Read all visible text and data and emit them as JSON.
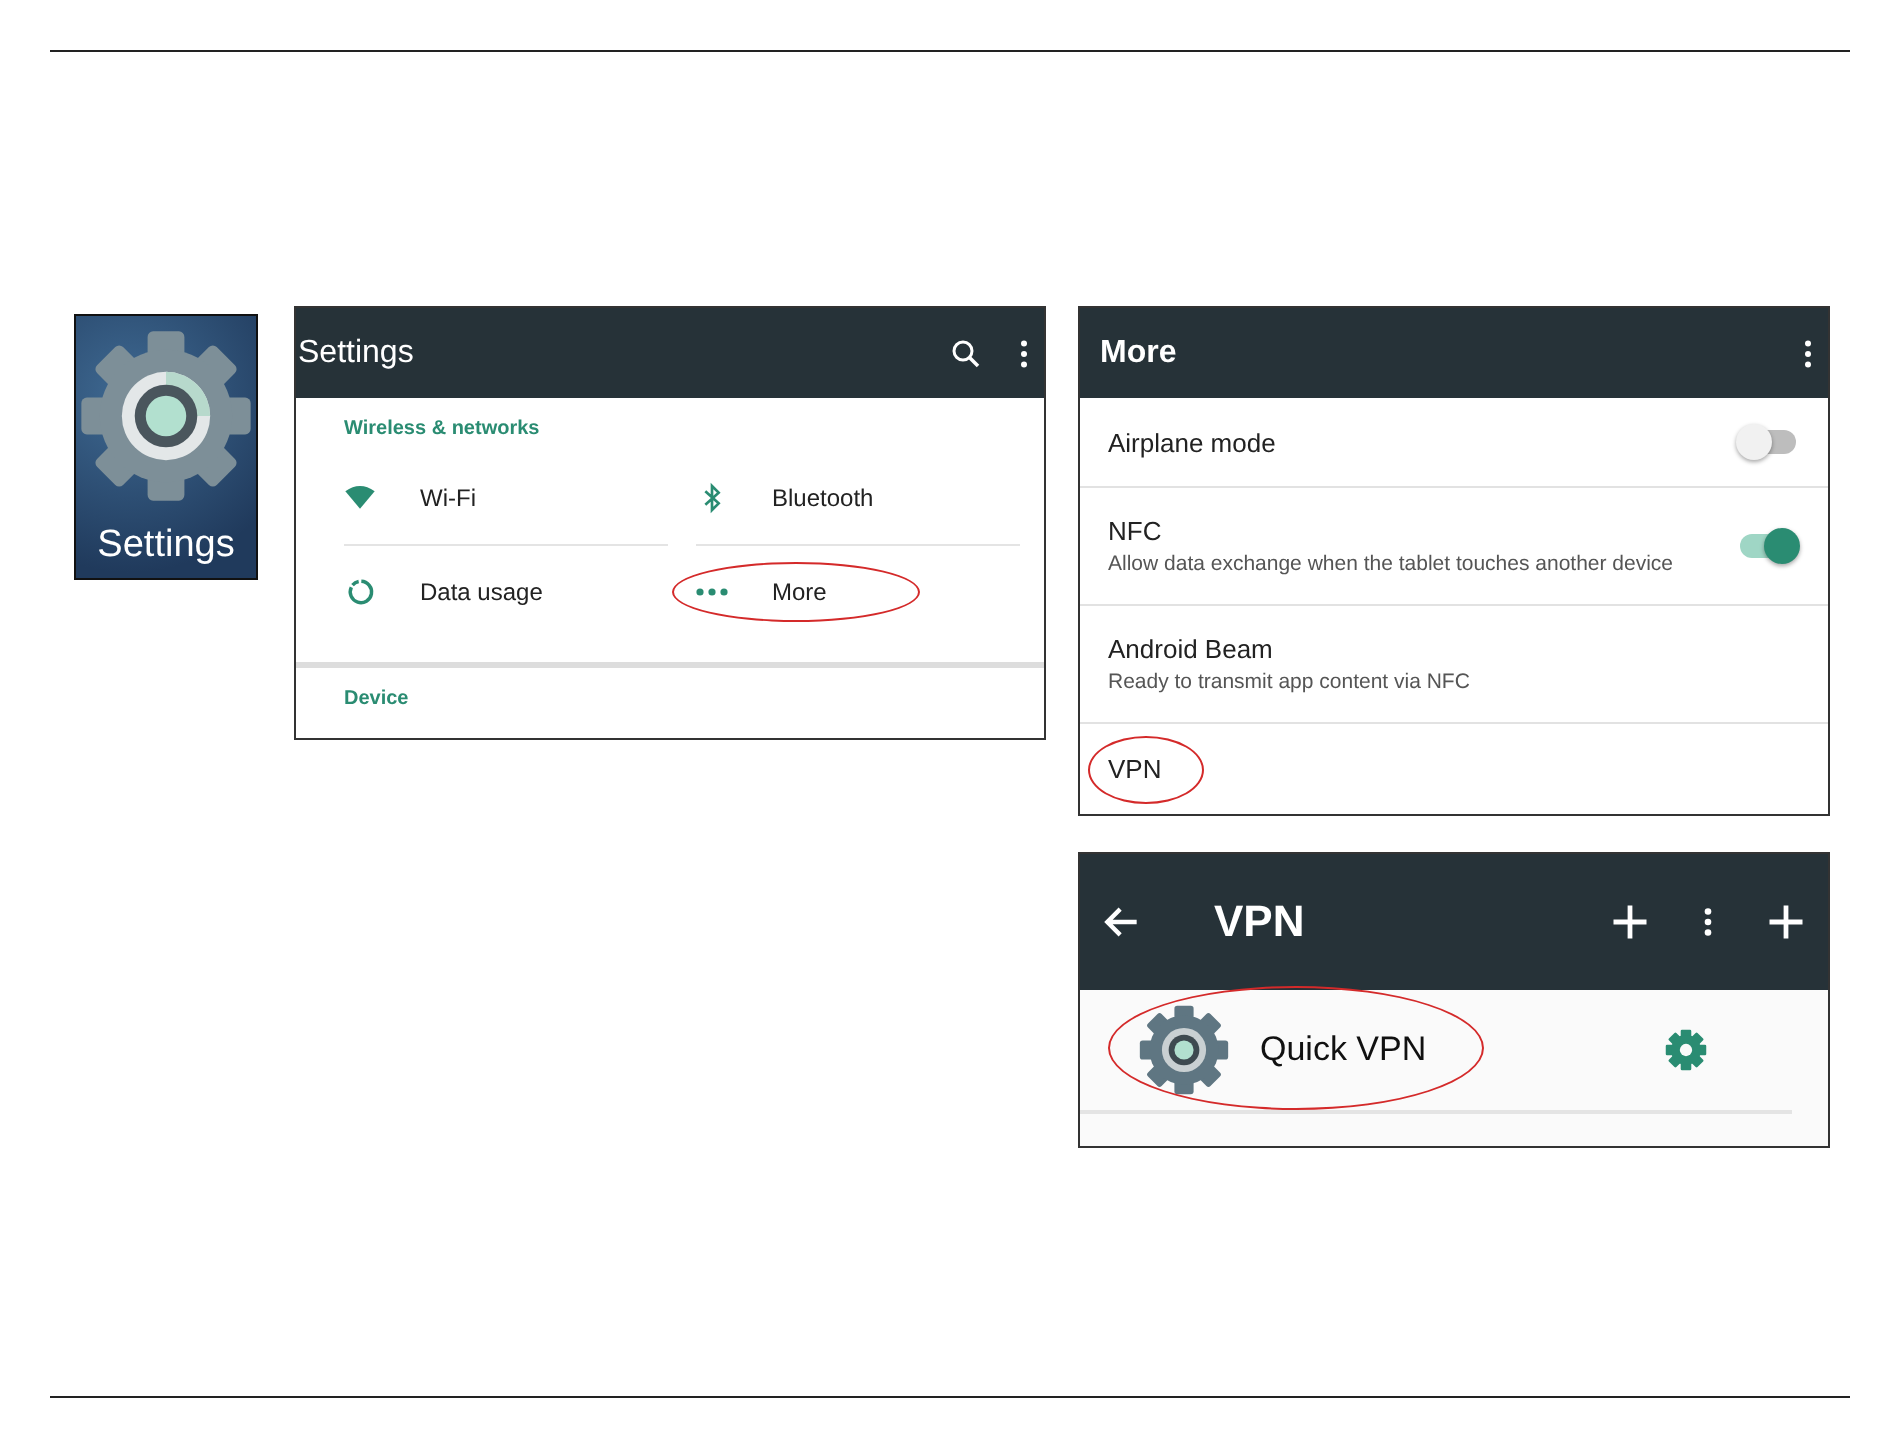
{
  "app_icon": {
    "label": "Settings"
  },
  "settings_screen": {
    "title": "Settings",
    "sections": [
      {
        "header": "Wireless & networks",
        "items": [
          {
            "kind": "wifi",
            "label": "Wi-Fi",
            "highlighted": false
          },
          {
            "kind": "bluetooth",
            "label": "Bluetooth",
            "highlighted": false
          },
          {
            "kind": "data",
            "label": "Data usage",
            "highlighted": false
          },
          {
            "kind": "more",
            "label": "More",
            "highlighted": true
          }
        ]
      },
      {
        "header": "Device"
      }
    ]
  },
  "more_screen": {
    "title": "More",
    "items": [
      {
        "kind": "toggle",
        "label": "Airplane mode",
        "on": false,
        "highlighted": false
      },
      {
        "kind": "toggle",
        "label": "NFC",
        "subtitle": "Allow data exchange when the tablet touches another device",
        "on": true,
        "highlighted": false
      },
      {
        "kind": "plain",
        "label": "Android Beam",
        "subtitle": "Ready to transmit app content via NFC",
        "highlighted": false
      },
      {
        "kind": "plain",
        "label": "VPN",
        "highlighted": true
      }
    ]
  },
  "vpn_screen": {
    "title": "VPN",
    "profiles": [
      {
        "name": "Quick VPN",
        "highlighted": true
      }
    ]
  }
}
